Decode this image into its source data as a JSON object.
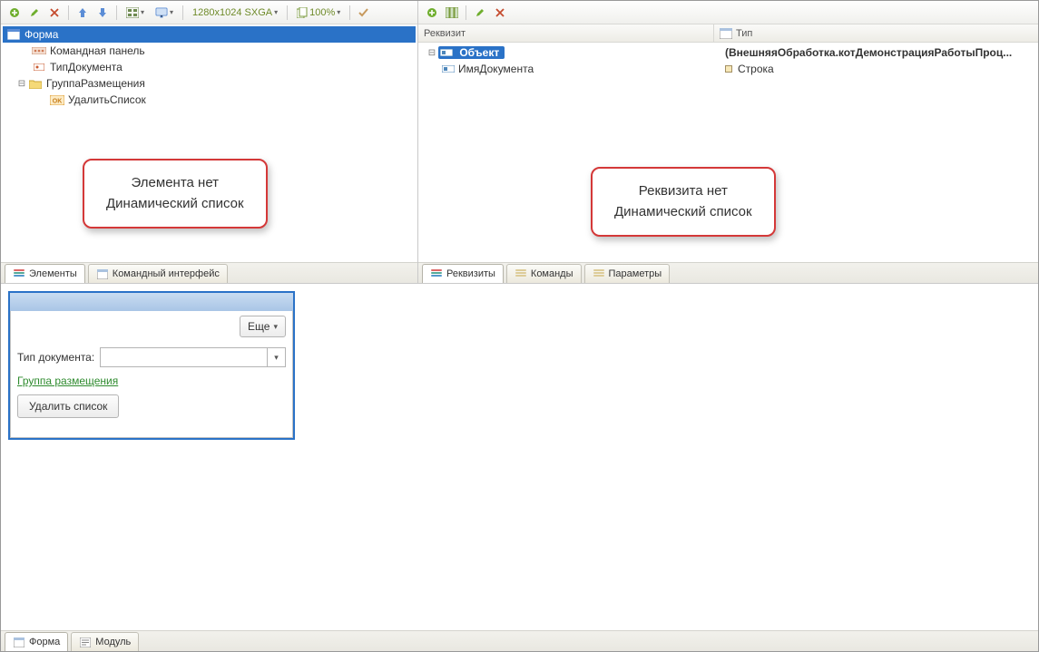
{
  "toolbar_left": {
    "resolution": "1280x1024 SXGA",
    "zoom": "100%"
  },
  "left_tree": {
    "root": "Форма",
    "items": [
      "Командная панель",
      "ТипДокумента",
      "ГруппаРазмещения",
      "УдалитьСписок"
    ]
  },
  "left_tabs": {
    "tab1": "Элементы",
    "tab2": "Командный интерфейс"
  },
  "callouts": {
    "left_line1": "Элемента нет",
    "left_line2": "Динамический список",
    "right_line1": "Реквизита нет",
    "right_line2": "Динамический список"
  },
  "right_header": {
    "col_attr": "Реквизит",
    "col_type": "Тип"
  },
  "right_rows": [
    {
      "name": "Объект",
      "type": "(ВнешняяОбработка.котДемонстрацияРаботыПроц...",
      "selected": true
    },
    {
      "name": "ИмяДокумента",
      "type": "Строка",
      "selected": false
    }
  ],
  "right_tabs": {
    "t1": "Реквизиты",
    "t2": "Команды",
    "t3": "Параметры"
  },
  "preview": {
    "more_btn": "Еще",
    "label_tip": "Тип документа:",
    "group_link": "Группа размещения",
    "delete_btn": "Удалить список"
  },
  "footer_tabs": {
    "t1": "Форма",
    "t2": "Модуль"
  }
}
